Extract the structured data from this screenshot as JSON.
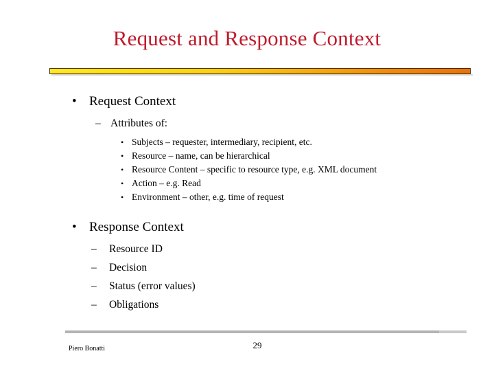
{
  "slide": {
    "title": "Request and Response Context",
    "title_color": "#BF1B2C",
    "background_color": "#FFFFFF",
    "rule_gradient_start": "#FFE017",
    "rule_gradient_end": "#E8730C"
  },
  "content": {
    "section1": {
      "bullet_mark": "•",
      "heading": "Request Context",
      "sub": {
        "mark": "–",
        "label": "Attributes of:"
      },
      "items": [
        {
          "mark": "•",
          "text": "Subjects – requester, intermediary, recipient, etc."
        },
        {
          "mark": "•",
          "text": "Resource – name, can be hierarchical"
        },
        {
          "mark": "•",
          "text": "Resource Content – specific to resource type, e.g. XML document"
        },
        {
          "mark": "•",
          "text": "Action – e.g. Read"
        },
        {
          "mark": "•",
          "text": "Environment – other, e.g. time of request"
        }
      ]
    },
    "section2": {
      "bullet_mark": "•",
      "heading": "Response Context",
      "items": [
        {
          "mark": "–",
          "text": "Resource ID"
        },
        {
          "mark": "–",
          "text": "Decision"
        },
        {
          "mark": "–",
          "text": "Status (error values)"
        },
        {
          "mark": "–",
          "text": "Obligations"
        }
      ]
    }
  },
  "footer": {
    "author": "Piero Bonatti",
    "page_number": "29",
    "rule_color": "#B3B3B3"
  }
}
